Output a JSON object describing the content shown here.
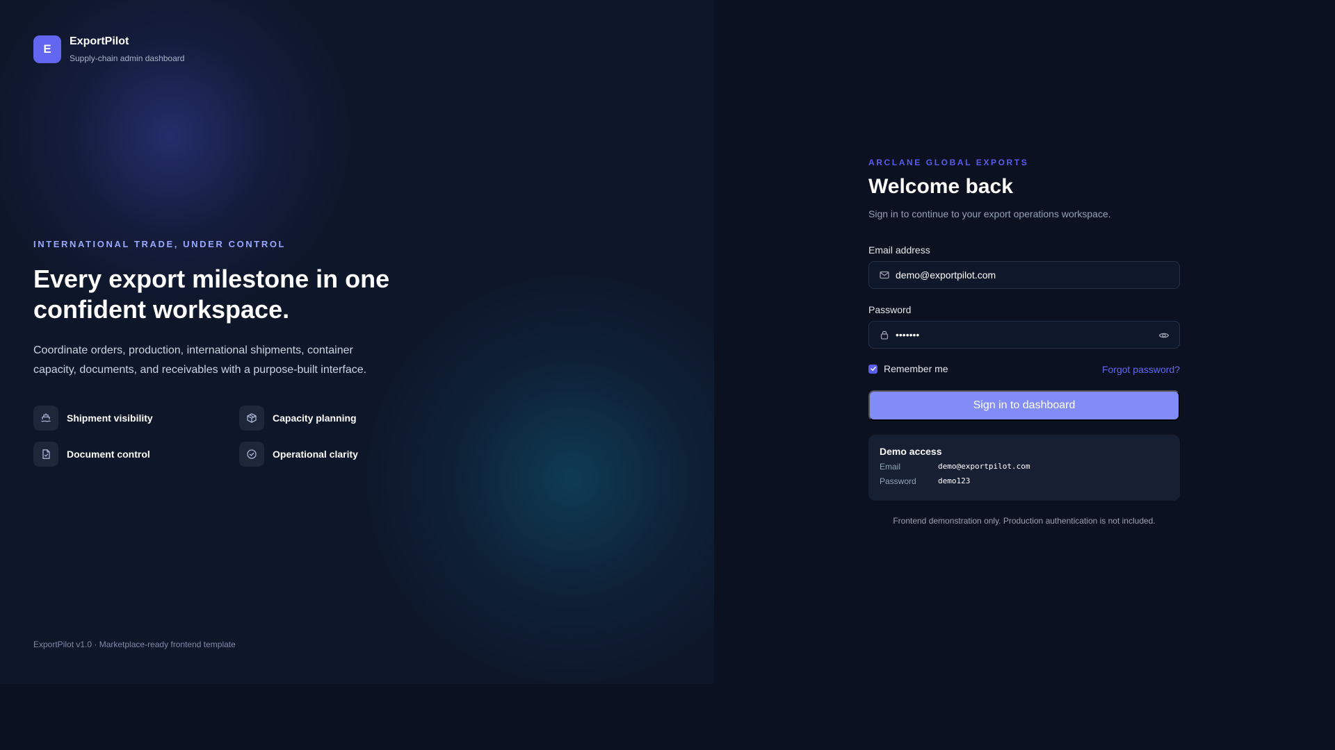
{
  "brand": {
    "logo_letter": "E",
    "name": "ExportPilot",
    "tagline": "Supply-chain admin dashboard"
  },
  "hero": {
    "eyebrow": "INTERNATIONAL TRADE, UNDER CONTROL",
    "title": "Every export milestone in one confident workspace.",
    "description": "Coordinate orders, production, international shipments, container capacity, documents, and receivables with a purpose-built interface.",
    "features": [
      {
        "label": "Shipment visibility",
        "icon": "ship-icon"
      },
      {
        "label": "Capacity planning",
        "icon": "box-icon"
      },
      {
        "label": "Document control",
        "icon": "document-icon"
      },
      {
        "label": "Operational clarity",
        "icon": "check-circle-icon"
      }
    ],
    "footer": "ExportPilot v1.0 · Marketplace-ready frontend template"
  },
  "login": {
    "org": "ARCLANE GLOBAL EXPORTS",
    "title": "Welcome back",
    "subtitle": "Sign in to continue to your export operations workspace.",
    "email_label": "Email address",
    "email_value": "demo@exportpilot.com",
    "password_label": "Password",
    "password_value": "•••••••",
    "remember_label": "Remember me",
    "remember_checked": true,
    "forgot_label": "Forgot password?",
    "submit_label": "Sign in to dashboard",
    "demo": {
      "title": "Demo access",
      "email_key": "Email",
      "email_val": "demo@exportpilot.com",
      "password_key": "Password",
      "password_val": "demo123"
    },
    "note": "Frontend demonstration only. Production authentication is not included."
  },
  "colors": {
    "accent": "#6366f1",
    "button": "#818cf8",
    "background": "#0b1120"
  }
}
